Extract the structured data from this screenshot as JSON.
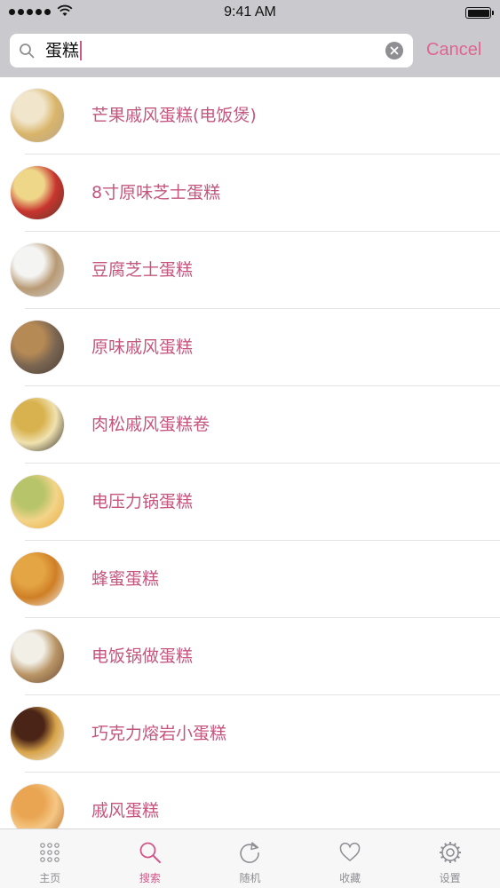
{
  "status_bar": {
    "time": "9:41 AM"
  },
  "search": {
    "query": "蛋糕",
    "cancel_label": "Cancel"
  },
  "results": [
    {
      "title": "芒果戚风蛋糕(电饭煲)",
      "thumb_colors": [
        "#b7a48c",
        "#f1e6cc",
        "#d9b56a"
      ]
    },
    {
      "title": "8寸原味芝士蛋糕",
      "thumb_colors": [
        "#5a3a2a",
        "#efd78a",
        "#c8342e"
      ]
    },
    {
      "title": "豆腐芝士蛋糕",
      "thumb_colors": [
        "#cfcfcf",
        "#f4f4f2",
        "#b89a74"
      ]
    },
    {
      "title": "原味戚风蛋糕",
      "thumb_colors": [
        "#4a3f35",
        "#b68a55",
        "#7a6551"
      ]
    },
    {
      "title": "肉松戚风蛋糕卷",
      "thumb_colors": [
        "#2a2622",
        "#d8b24f",
        "#f0e2b0"
      ]
    },
    {
      "title": "电压力锅蛋糕",
      "thumb_colors": [
        "#e9a93a",
        "#b7c46a",
        "#f3d489"
      ]
    },
    {
      "title": "蜂蜜蛋糕",
      "thumb_colors": [
        "#f2efe9",
        "#e4a545",
        "#cf7f25"
      ]
    },
    {
      "title": "电饭锅做蛋糕",
      "thumb_colors": [
        "#6b4a33",
        "#f1efe6",
        "#b99566"
      ]
    },
    {
      "title": "巧克力熔岩小蛋糕",
      "thumb_colors": [
        "#f3eee3",
        "#4a2416",
        "#d8a44a"
      ]
    },
    {
      "title": "戚风蛋糕",
      "thumb_colors": [
        "#b76a2b",
        "#e9a552",
        "#f5c784"
      ]
    }
  ],
  "tabs": [
    {
      "label": "主页",
      "icon": "grid-icon",
      "active": false
    },
    {
      "label": "搜索",
      "icon": "search-icon",
      "active": true
    },
    {
      "label": "随机",
      "icon": "refresh-icon",
      "active": false
    },
    {
      "label": "收藏",
      "icon": "heart-icon",
      "active": false
    },
    {
      "label": "设置",
      "icon": "gear-icon",
      "active": false
    }
  ],
  "colors": {
    "accent": "#d1568a",
    "result_text": "#c4567e",
    "header_bg": "#c9c9ce",
    "tab_inactive": "#8e8e93"
  }
}
